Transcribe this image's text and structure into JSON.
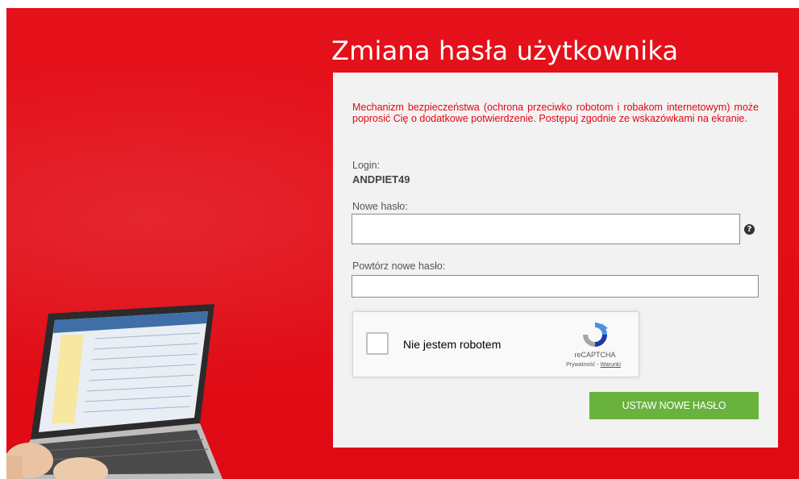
{
  "page": {
    "title": "Zmiana hasła użytkownika"
  },
  "form": {
    "notice": "Mechanizm bezpieczeństwa (ochrona przeciwko robotom i robakom internetowym) może poprosić Cię o dodatkowe potwierdzenie. Postępuj zgodnie ze wskazówkami na ekranie.",
    "login_label": "Login:",
    "login_value": "ANDPIET49",
    "new_password_label": "Nowe hasło:",
    "new_password_value": "",
    "help_icon_glyph": "?",
    "repeat_password_label": "Powtórz nowe hasło:",
    "repeat_password_value": "",
    "submit_label": "USTAW NOWE HASŁO"
  },
  "captcha": {
    "checkbox_label": "Nie jestem robotem",
    "brand": "reCAPTCHA",
    "privacy_link": "Prywatność",
    "separator": " - ",
    "terms_link": "Warunki"
  },
  "colors": {
    "brand_red": "#e30613",
    "submit_green": "#6ab23e",
    "panel_bg": "#f2f2f2",
    "notice_text": "#e30613"
  },
  "icons": {
    "help": "help-icon",
    "recaptcha_logo": "recaptcha-icon",
    "laptop": "laptop-illustration"
  }
}
